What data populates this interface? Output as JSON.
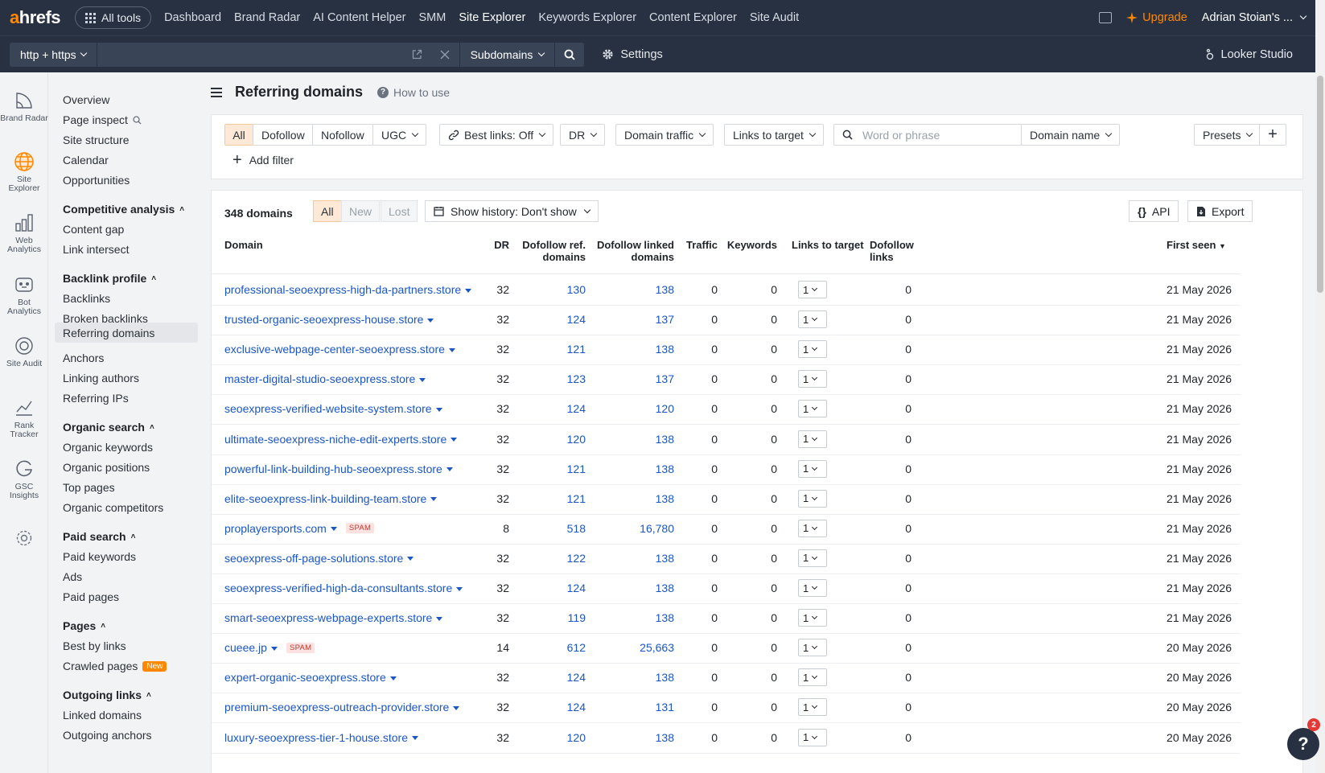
{
  "topnav": {
    "logo_accent": "a",
    "logo_rest": "hrefs",
    "all_tools": "All tools",
    "links": [
      "Dashboard",
      "Brand Radar",
      "AI Content Helper",
      "SMM",
      "Site Explorer",
      "Keywords Explorer",
      "Content Explorer",
      "Site Audit"
    ],
    "active_link": "Site Explorer",
    "upgrade": "Upgrade",
    "user": "Adrian Stoian's ..."
  },
  "subbar": {
    "protocol": "http + https",
    "url_value": "",
    "mode": "Subdomains",
    "settings": "Settings",
    "looker": "Looker Studio"
  },
  "rail": [
    {
      "icon": "brand-radar-icon",
      "label": "Brand Radar"
    },
    {
      "icon": "site-explorer-icon",
      "label": "Site Explorer"
    },
    {
      "icon": "web-analytics-icon",
      "label": "Web Analytics"
    },
    {
      "icon": "bot-analytics-icon",
      "label": "Bot Analytics"
    },
    {
      "icon": "site-audit-icon",
      "label": "Site Audit"
    },
    {
      "icon": "rank-tracker-icon",
      "label": "Rank Tracker"
    },
    {
      "icon": "gsc-insights-icon",
      "label": "GSC Insights"
    },
    {
      "icon": "settings-gear-icon",
      "label": ""
    }
  ],
  "sidebar": {
    "overview": "Overview",
    "page_inspect": "Page inspect",
    "site_structure": "Site structure",
    "calendar": "Calendar",
    "opportunities": "Opportunities",
    "competitive": "Competitive analysis",
    "content_gap": "Content gap",
    "link_intersect": "Link intersect",
    "backlink_profile": "Backlink profile",
    "backlinks": "Backlinks",
    "broken_backlinks": "Broken backlinks",
    "referring_domains": "Referring domains",
    "anchors": "Anchors",
    "linking_authors": "Linking authors",
    "referring_ips": "Referring IPs",
    "organic_search": "Organic search",
    "organic_keywords": "Organic keywords",
    "organic_positions": "Organic positions",
    "top_pages": "Top pages",
    "organic_competitors": "Organic competitors",
    "paid_search": "Paid search",
    "paid_keywords": "Paid keywords",
    "ads": "Ads",
    "paid_pages": "Paid pages",
    "pages": "Pages",
    "best_by_links": "Best by links",
    "crawled_pages": "Crawled pages",
    "new_badge": "New",
    "outgoing_links": "Outgoing links",
    "linked_domains": "Linked domains",
    "outgoing_anchors": "Outgoing anchors"
  },
  "page": {
    "title": "Referring domains",
    "how_to": "How to use"
  },
  "filters": {
    "all": "All",
    "dofollow": "Dofollow",
    "nofollow": "Nofollow",
    "ugc": "UGC",
    "best_links": "Best links: Off",
    "dr": "DR",
    "domain_traffic": "Domain traffic",
    "links_to_target": "Links to target",
    "search_placeholder": "Word or phrase",
    "domain_name": "Domain name",
    "presets": "Presets",
    "add_filter": "Add filter"
  },
  "table": {
    "count": "348 domains",
    "seg_all": "All",
    "seg_new": "New",
    "seg_lost": "Lost",
    "history": "Show history: Don't show",
    "api": "API",
    "export": "Export",
    "headers": {
      "domain": "Domain",
      "dr": "DR",
      "dofollow_ref_1": "Dofollow ref.",
      "dofollow_ref_2": "domains",
      "dofollow_linked_1": "Dofollow linked",
      "dofollow_linked_2": "domains",
      "traffic": "Traffic",
      "keywords": "Keywords",
      "links_to_target": "Links to target",
      "dofollow_links_1": "Dofollow",
      "dofollow_links_2": "links",
      "first_seen": "First seen"
    },
    "rows": [
      {
        "domain": "professional-seoexpress-high-da-partners.store",
        "spam": "",
        "dr": "32",
        "ref": "130",
        "linked": "138",
        "traffic": "0",
        "keywords": "0",
        "ltt": "1",
        "dofollow": "0",
        "first_seen": "21 May 2026"
      },
      {
        "domain": "trusted-organic-seoexpress-house.store",
        "spam": "",
        "dr": "32",
        "ref": "124",
        "linked": "137",
        "traffic": "0",
        "keywords": "0",
        "ltt": "1",
        "dofollow": "0",
        "first_seen": "21 May 2026"
      },
      {
        "domain": "exclusive-webpage-center-seoexpress.store",
        "spam": "",
        "dr": "32",
        "ref": "121",
        "linked": "138",
        "traffic": "0",
        "keywords": "0",
        "ltt": "1",
        "dofollow": "0",
        "first_seen": "21 May 2026"
      },
      {
        "domain": "master-digital-studio-seoexpress.store",
        "spam": "",
        "dr": "32",
        "ref": "123",
        "linked": "137",
        "traffic": "0",
        "keywords": "0",
        "ltt": "1",
        "dofollow": "0",
        "first_seen": "21 May 2026"
      },
      {
        "domain": "seoexpress-verified-website-system.store",
        "spam": "",
        "dr": "32",
        "ref": "124",
        "linked": "120",
        "traffic": "0",
        "keywords": "0",
        "ltt": "1",
        "dofollow": "0",
        "first_seen": "21 May 2026"
      },
      {
        "domain": "ultimate-seoexpress-niche-edit-experts.store",
        "spam": "",
        "dr": "32",
        "ref": "120",
        "linked": "138",
        "traffic": "0",
        "keywords": "0",
        "ltt": "1",
        "dofollow": "0",
        "first_seen": "21 May 2026"
      },
      {
        "domain": "powerful-link-building-hub-seoexpress.store",
        "spam": "",
        "dr": "32",
        "ref": "121",
        "linked": "138",
        "traffic": "0",
        "keywords": "0",
        "ltt": "1",
        "dofollow": "0",
        "first_seen": "21 May 2026"
      },
      {
        "domain": "elite-seoexpress-link-building-team.store",
        "spam": "",
        "dr": "32",
        "ref": "121",
        "linked": "138",
        "traffic": "0",
        "keywords": "0",
        "ltt": "1",
        "dofollow": "0",
        "first_seen": "21 May 2026"
      },
      {
        "domain": "proplayersports.com",
        "spam": "SPAM",
        "dr": "8",
        "ref": "518",
        "linked": "16,780",
        "traffic": "0",
        "keywords": "0",
        "ltt": "1",
        "dofollow": "0",
        "first_seen": "21 May 2026"
      },
      {
        "domain": "seoexpress-off-page-solutions.store",
        "spam": "",
        "dr": "32",
        "ref": "122",
        "linked": "138",
        "traffic": "0",
        "keywords": "0",
        "ltt": "1",
        "dofollow": "0",
        "first_seen": "21 May 2026"
      },
      {
        "domain": "seoexpress-verified-high-da-consultants.store",
        "spam": "",
        "dr": "32",
        "ref": "124",
        "linked": "138",
        "traffic": "0",
        "keywords": "0",
        "ltt": "1",
        "dofollow": "0",
        "first_seen": "21 May 2026"
      },
      {
        "domain": "smart-seoexpress-webpage-experts.store",
        "spam": "",
        "dr": "32",
        "ref": "119",
        "linked": "138",
        "traffic": "0",
        "keywords": "0",
        "ltt": "1",
        "dofollow": "0",
        "first_seen": "21 May 2026"
      },
      {
        "domain": "cueee.jp",
        "spam": "SPAM",
        "dr": "14",
        "ref": "612",
        "linked": "25,663",
        "traffic": "0",
        "keywords": "0",
        "ltt": "1",
        "dofollow": "0",
        "first_seen": "20 May 2026"
      },
      {
        "domain": "expert-organic-seoexpress.store",
        "spam": "",
        "dr": "32",
        "ref": "124",
        "linked": "138",
        "traffic": "0",
        "keywords": "0",
        "ltt": "1",
        "dofollow": "0",
        "first_seen": "20 May 2026"
      },
      {
        "domain": "premium-seoexpress-outreach-provider.store",
        "spam": "",
        "dr": "32",
        "ref": "124",
        "linked": "131",
        "traffic": "0",
        "keywords": "0",
        "ltt": "1",
        "dofollow": "0",
        "first_seen": "20 May 2026"
      },
      {
        "domain": "luxury-seoexpress-tier-1-house.store",
        "spam": "",
        "dr": "32",
        "ref": "120",
        "linked": "138",
        "traffic": "0",
        "keywords": "0",
        "ltt": "1",
        "dofollow": "0",
        "first_seen": "20 May 2026"
      }
    ]
  },
  "help": {
    "label": "?",
    "badge": "2"
  },
  "colors": {
    "nav_bg": "#283142",
    "accent": "#ff8800",
    "link": "#1a56c4",
    "spam_bg": "#fde2e2"
  }
}
